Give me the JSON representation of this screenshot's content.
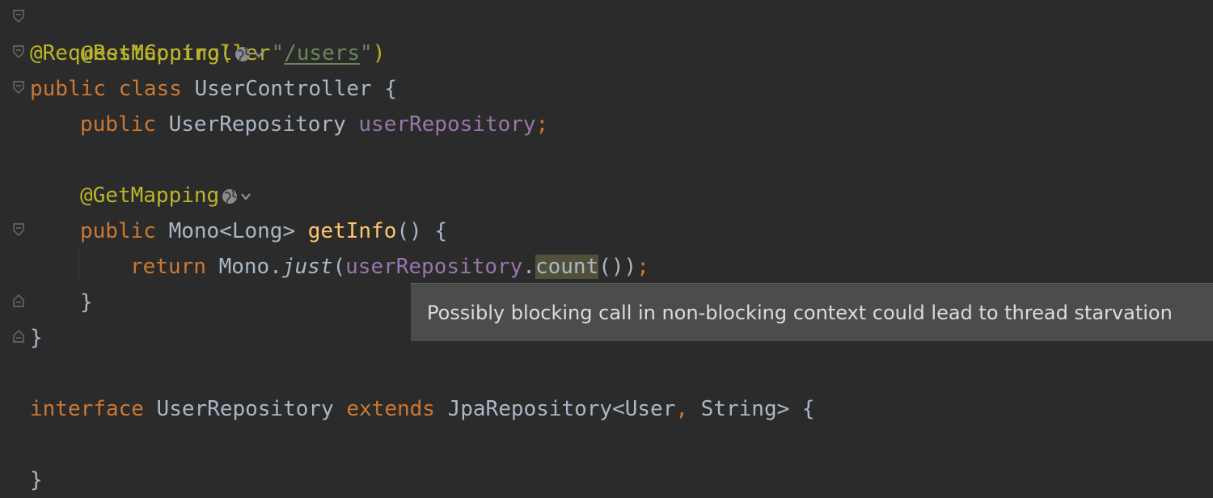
{
  "editor": {
    "lines": {
      "l1": {
        "annotation": "@RestController"
      },
      "l2": {
        "annotation": "@RequestMapping(",
        "quote_open": "\"",
        "path": "/users",
        "quote_close": "\"",
        "close": ")"
      },
      "l3": {
        "kw_public": "public",
        "kw_class": "class",
        "class_name": "UserController",
        "brace": "{"
      },
      "l4": {
        "kw_public": "public",
        "type": "UserRepository",
        "field": "userRepository",
        "semi": ";"
      },
      "l6": {
        "annotation": "@GetMapping"
      },
      "l7": {
        "kw_public": "public",
        "type": "Mono<Long>",
        "method": "getInfo",
        "rest": "() {"
      },
      "l8": {
        "kw_return": "return",
        "cls": "Mono.",
        "call": "just",
        "paren": "(",
        "field": "userRepository",
        "dot": ".",
        "highlighted": "count",
        "end_paren": "())",
        "semi": ";"
      },
      "l9": {
        "brace": "}"
      },
      "l10": {
        "brace": "}"
      },
      "l12": {
        "kw_interface": "interface",
        "name": "UserRepository",
        "kw_extends": "extends",
        "generic": "JpaRepository<User",
        "comma": ",",
        "generic2": "String>",
        "brace": "{"
      },
      "l14": {
        "brace": "}"
      }
    },
    "icons": {
      "globe": "globe-icon",
      "fold": "fold-marker-icon"
    },
    "colors": {
      "background": "#2b2b2b",
      "annotation": "#bbb529",
      "keyword": "#cc7832",
      "string": "#6a8759",
      "field": "#9876aa",
      "method": "#ffc66d",
      "text": "#a9b7c6"
    }
  },
  "tooltip": {
    "message": "Possibly blocking call in non-blocking context could lead to thread starvation"
  }
}
